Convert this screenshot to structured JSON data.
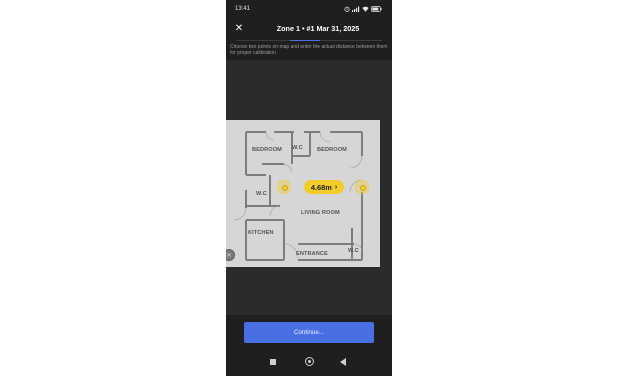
{
  "status_bar": {
    "time": "13:41",
    "icons": [
      "alarm-icon",
      "signal-icon",
      "wifi-icon",
      "battery-icon"
    ]
  },
  "header": {
    "title": "Zone 1 • #1 Mar 31, 2025",
    "close_icon": "close-icon"
  },
  "instructions": "Choose two points on map and enter the actual distance between them for proper calibration",
  "floor_plan": {
    "rooms": [
      "BEDROOM",
      "W.C",
      "BEDROOM",
      "W.C",
      "LIVING ROOM",
      "KITCHEN",
      "ENTRANCE",
      "W.C"
    ]
  },
  "measurement": {
    "distance": "4.68m",
    "accent_color": "#f2cc2a"
  },
  "actions": {
    "continue_label": "Continue..."
  },
  "colors": {
    "primary": "#4a6fe3",
    "background": "#1f1f1f"
  }
}
